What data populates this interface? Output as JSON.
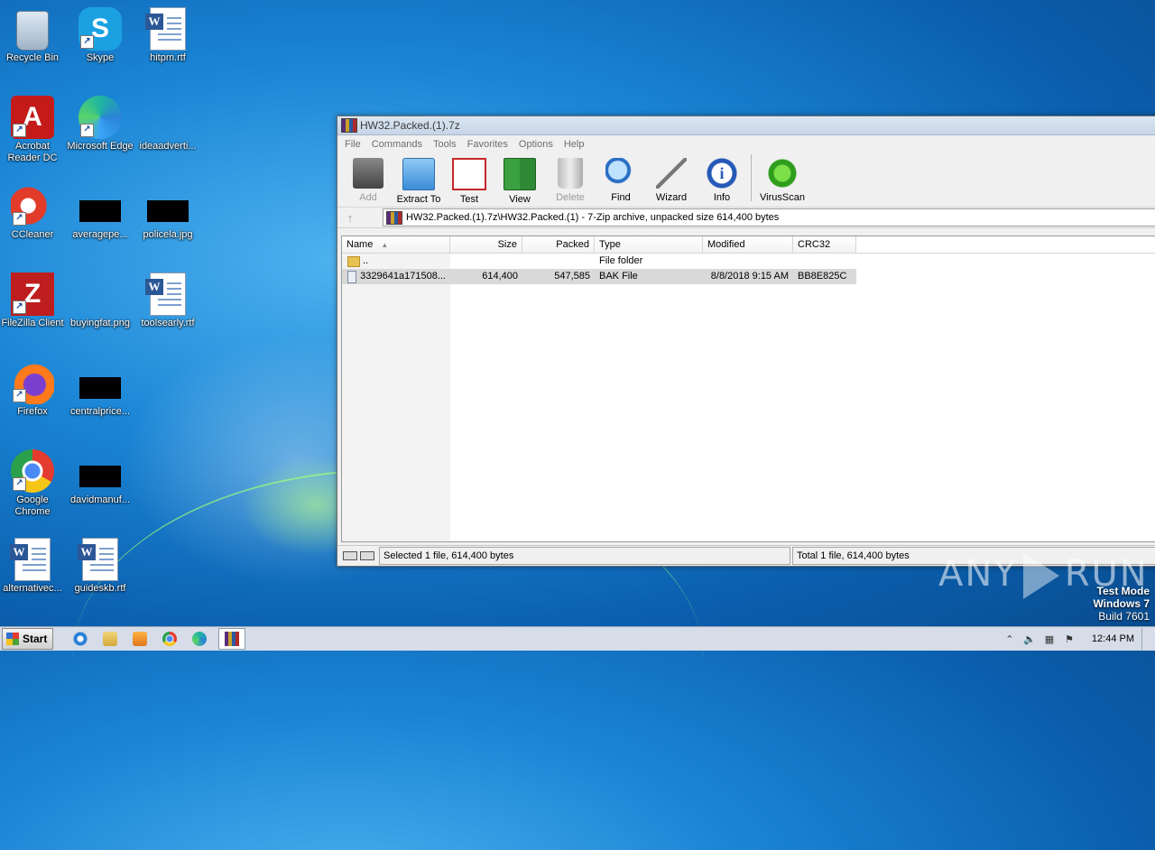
{
  "desktop": {
    "icons": [
      {
        "label": "Recycle Bin",
        "icon": "recycle-bin-icon"
      },
      {
        "label": "Skype",
        "icon": "skype-icon"
      },
      {
        "label": "hitpm.rtf",
        "icon": "word-document-icon"
      },
      {
        "label": "Acrobat Reader DC",
        "icon": "acrobat-icon"
      },
      {
        "label": "Microsoft Edge",
        "icon": "edge-icon"
      },
      {
        "label": "ideaadverti...",
        "icon": "file-icon"
      },
      {
        "label": "CCleaner",
        "icon": "ccleaner-icon"
      },
      {
        "label": "averagepe...",
        "icon": "black-thumbnail-icon"
      },
      {
        "label": "policela.jpg",
        "icon": "black-thumbnail-icon"
      },
      {
        "label": "FileZilla Client",
        "icon": "filezilla-icon"
      },
      {
        "label": "buyingfat.png",
        "icon": "file-icon"
      },
      {
        "label": "toolsearly.rtf",
        "icon": "word-document-icon"
      },
      {
        "label": "Firefox",
        "icon": "firefox-icon"
      },
      {
        "label": "centralprice...",
        "icon": "black-thumbnail-icon"
      },
      {
        "label": "Google Chrome",
        "icon": "chrome-icon"
      },
      {
        "label": "davidmanuf...",
        "icon": "black-thumbnail-icon"
      },
      {
        "label": "alternativec...",
        "icon": "word-document-icon"
      },
      {
        "label": "guideskb.rtf",
        "icon": "word-document-icon"
      }
    ]
  },
  "window": {
    "title": "HW32.Packed.(1).7z",
    "menu": [
      "File",
      "Commands",
      "Tools",
      "Favorites",
      "Options",
      "Help"
    ],
    "toolbar": [
      {
        "label": "Add",
        "icon": "add-icon",
        "enabled": false
      },
      {
        "label": "Extract To",
        "icon": "extract-folder-icon",
        "enabled": true
      },
      {
        "label": "Test",
        "icon": "test-clipboard-icon",
        "enabled": true
      },
      {
        "label": "View",
        "icon": "view-book-icon",
        "enabled": true
      },
      {
        "label": "Delete",
        "icon": "trash-icon",
        "enabled": false
      },
      {
        "label": "Find",
        "icon": "magnifier-icon",
        "enabled": true
      },
      {
        "label": "Wizard",
        "icon": "wand-icon",
        "enabled": true
      },
      {
        "label": "Info",
        "icon": "info-icon",
        "enabled": true
      },
      {
        "label": "VirusScan",
        "icon": "virus-scan-icon",
        "enabled": true
      }
    ],
    "address": "HW32.Packed.(1).7z\\HW32.Packed.(1) - 7-Zip archive, unpacked size 614,400 bytes",
    "columns": [
      "Name",
      "Size",
      "Packed",
      "Type",
      "Modified",
      "CRC32"
    ],
    "rows": [
      {
        "name": "..",
        "size": "",
        "packed": "",
        "type": "File folder",
        "modified": "",
        "crc": "",
        "icon": "folder-icon",
        "selected": false
      },
      {
        "name": "3329641a171508...",
        "size": "614,400",
        "packed": "547,585",
        "type": "BAK File",
        "modified": "8/8/2018 9:15 AM",
        "crc": "BB8E825C",
        "icon": "file-icon",
        "selected": true
      }
    ],
    "status_left": "Selected 1 file, 614,400 bytes",
    "status_right": "Total 1 file, 614,400 bytes"
  },
  "watermark": {
    "text_left": "ANY",
    "text_right": "RUN"
  },
  "os_notice": {
    "line1": "Test Mode",
    "line2": "Windows 7",
    "line3": "Build 7601"
  },
  "taskbar": {
    "start_label": "Start",
    "pinned": [
      "internet-explorer-icon",
      "explorer-folder-icon",
      "media-player-icon",
      "chrome-icon",
      "edge-icon",
      "winrar-icon"
    ],
    "clock": "12:44 PM"
  },
  "colors": {
    "selection": "#d9d9d9",
    "desktop": "#1b86d6"
  }
}
